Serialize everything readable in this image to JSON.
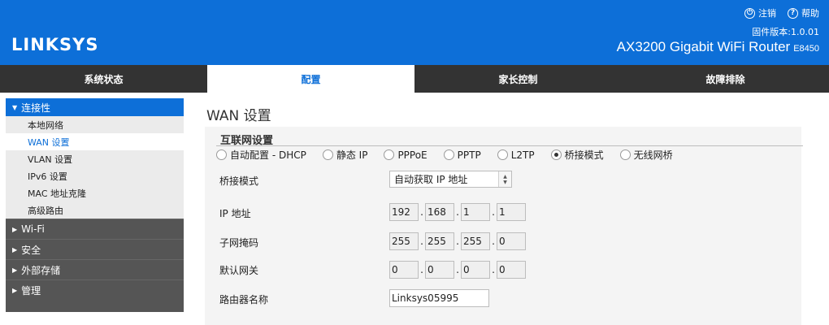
{
  "header": {
    "logo": "LINKSYS",
    "logout": "注销",
    "help": "帮助",
    "firmware": "固件版本:1.0.01",
    "model_name": "AX3200 Gigabit WiFi Router",
    "model_code": "E8450",
    "background_color": "#0d6fd8"
  },
  "tabs": [
    {
      "label": "系统状态"
    },
    {
      "label": "配置"
    },
    {
      "label": "家长控制"
    },
    {
      "label": "故障排除"
    }
  ],
  "sidebar": {
    "connectivity": "连接性",
    "sub_items": [
      {
        "label": "本地网络"
      },
      {
        "label": "WAN 设置"
      },
      {
        "label": "VLAN 设置"
      },
      {
        "label": "IPv6 设置"
      },
      {
        "label": "MAC 地址克隆"
      },
      {
        "label": "高级路由"
      }
    ],
    "collapsed": [
      {
        "label": "Wi-Fi"
      },
      {
        "label": "安全"
      },
      {
        "label": "外部存储"
      },
      {
        "label": "管理"
      }
    ]
  },
  "main": {
    "title": "WAN 设置",
    "section_title": "互联网设置",
    "connection_types": [
      {
        "label": "自动配置 - DHCP",
        "selected": false
      },
      {
        "label": "静态 IP",
        "selected": false
      },
      {
        "label": "PPPoE",
        "selected": false
      },
      {
        "label": "PPTP",
        "selected": false
      },
      {
        "label": "L2TP",
        "selected": false
      },
      {
        "label": "桥接模式",
        "selected": true
      },
      {
        "label": "无线网桥",
        "selected": false
      }
    ],
    "bridge_mode_label": "桥接模式",
    "bridge_mode_value": "自动获取 IP 地址",
    "ip_label": "IP 地址",
    "ip": [
      "192",
      "168",
      "1",
      "1"
    ],
    "subnet_label": "子网掩码",
    "subnet": [
      "255",
      "255",
      "255",
      "0"
    ],
    "gateway_label": "默认网关",
    "gateway": [
      "0",
      "0",
      "0",
      "0"
    ],
    "router_name_label": "路由器名称",
    "router_name": "Linksys05995"
  }
}
